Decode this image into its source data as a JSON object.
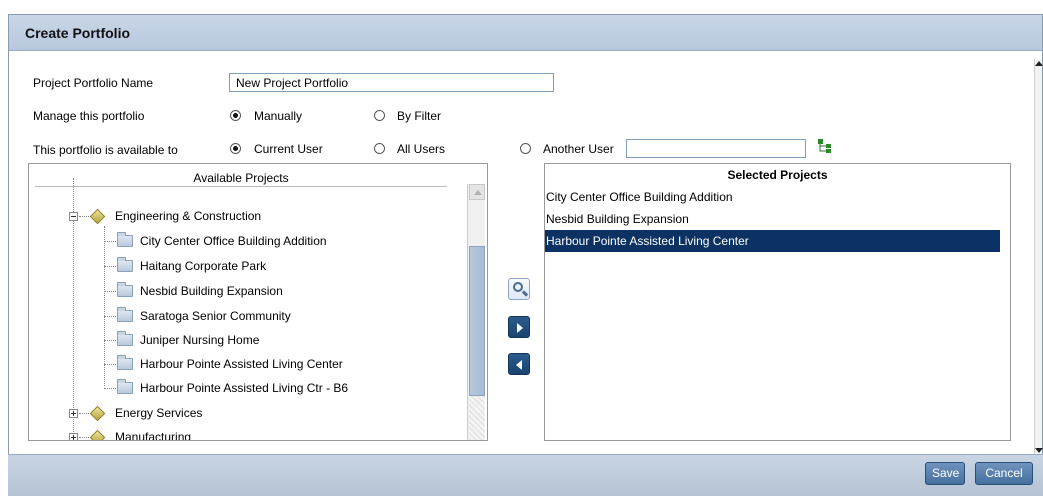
{
  "dialog": {
    "title": "Create Portfolio"
  },
  "form": {
    "portfolio_name_label": "Project Portfolio Name",
    "portfolio_name_value": "New Project Portfolio",
    "manage_label": "Manage this portfolio",
    "manage_options": [
      {
        "label": "Manually",
        "checked": true
      },
      {
        "label": "By Filter",
        "checked": false
      }
    ],
    "available_to_label": "This portfolio is available to",
    "available_to_options": [
      {
        "label": "Current User",
        "checked": true
      },
      {
        "label": "All Users",
        "checked": false
      },
      {
        "label": "Another User",
        "checked": false
      }
    ],
    "another_user_value": "",
    "user_picker_icon": "user-tree-icon"
  },
  "available": {
    "header": "Available Projects",
    "groups": [
      {
        "label": "Engineering & Construction",
        "expanded": true,
        "projects": [
          "City Center Office Building Addition",
          "Haitang Corporate Park",
          "Nesbid Building Expansion",
          "Saratoga Senior Community",
          "Juniper Nursing Home",
          "Harbour Pointe Assisted Living Center",
          "Harbour Pointe Assisted Living Ctr - B6"
        ]
      },
      {
        "label": "Energy Services",
        "expanded": false,
        "projects": []
      },
      {
        "label": "Manufacturing",
        "expanded": false,
        "projects": []
      }
    ]
  },
  "selected": {
    "header": "Selected Projects",
    "items": [
      {
        "label": "City Center Office Building Addition",
        "selected": false
      },
      {
        "label": "Nesbid Building Expansion",
        "selected": false
      },
      {
        "label": "Harbour Pointe Assisted Living Center",
        "selected": true
      }
    ]
  },
  "transfer_icons": {
    "search": "magnifier-icon",
    "add": "arrow-right-icon",
    "remove": "arrow-left-icon"
  },
  "footer": {
    "save_label": "Save",
    "cancel_label": "Cancel"
  },
  "colors": {
    "selection": "#0b3263",
    "header_bg": "#c9d6e7",
    "button_bg": "#46709f"
  }
}
